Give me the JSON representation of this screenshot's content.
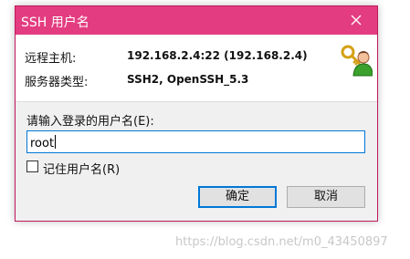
{
  "window": {
    "title": "SSH 用户名",
    "title_bar_color": "#e33c80"
  },
  "info": {
    "host_label": "远程主机:",
    "host_value": "192.168.2.4:22 (192.168.2.4)",
    "server_type_label": "服务器类型:",
    "server_type_value": "SSH2, OpenSSH_5.3",
    "icon": "user-key-icon"
  },
  "form": {
    "prompt_label": "请输入登录的用户名(E):",
    "username_value": "root",
    "remember_label": "记住用户名(R)",
    "remember_checked": false
  },
  "buttons": {
    "ok_label": "确定",
    "cancel_label": "取消"
  },
  "watermark": "https://blog.csdn.net/m0_43450897"
}
